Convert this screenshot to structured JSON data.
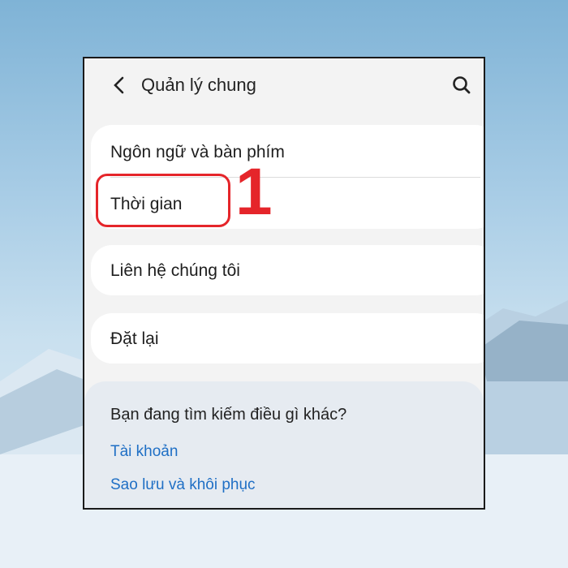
{
  "header": {
    "title": "Quản lý chung",
    "back_icon": "chevron-left-icon",
    "search_icon": "search-icon"
  },
  "menu": {
    "items": [
      {
        "label": "Ngôn ngữ và bàn phím"
      },
      {
        "label": "Thời gian"
      },
      {
        "label": "Liên hệ chúng tôi"
      },
      {
        "label": "Đặt lại"
      }
    ]
  },
  "annotation": {
    "step": "1",
    "color": "#e5252a"
  },
  "suggestions": {
    "title": "Bạn đang tìm kiếm điều gì khác?",
    "links": [
      "Tài khoản",
      "Sao lưu và khôi phục"
    ]
  },
  "colors": {
    "accent": "#1f6fc5",
    "highlight": "#e5252a"
  }
}
